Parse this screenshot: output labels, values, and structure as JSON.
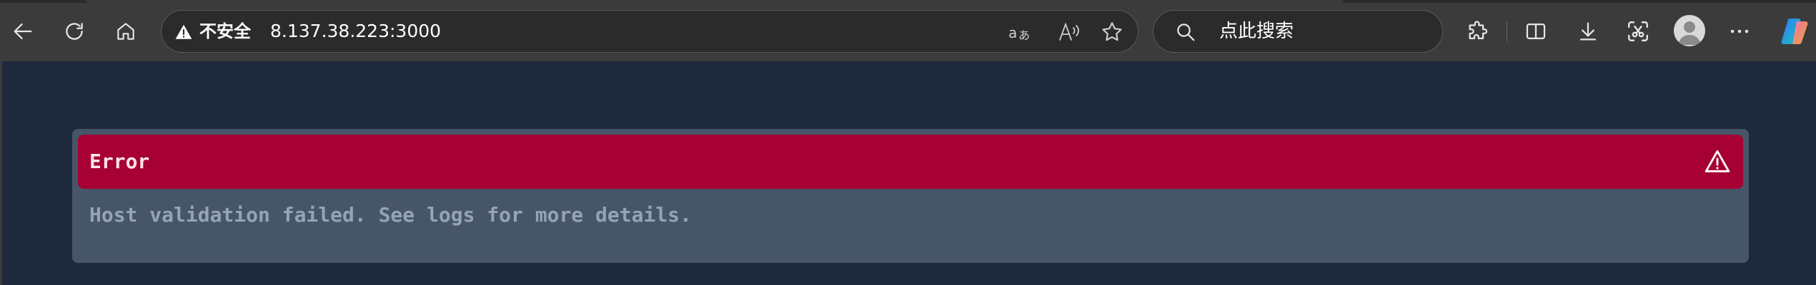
{
  "browser": {
    "security_label": "不安全",
    "url": "8.137.38.223:3000",
    "search_placeholder": "点此搜索",
    "icons": {
      "back": "back-arrow-icon",
      "refresh": "refresh-icon",
      "home": "home-icon",
      "security": "warning-triangle-icon",
      "translate": "translate-icon",
      "read_aloud": "read-aloud-icon",
      "favorite": "star-icon",
      "search": "search-icon",
      "extensions": "puzzle-icon",
      "split_screen": "split-screen-icon",
      "downloads": "download-icon",
      "screenshot": "screenshot-icon",
      "profile": "avatar",
      "more": "ellipsis-icon",
      "copilot": "copilot-icon"
    },
    "colors": {
      "toolbar_bg": "#3b3b3b",
      "field_bg": "#2b2b2b"
    }
  },
  "page": {
    "error": {
      "title": "Error",
      "message": "Host validation failed. See logs for more details.",
      "icon": "warning-triangle-icon"
    },
    "colors": {
      "page_bg": "#1e293b",
      "card_bg": "#475569",
      "header_bg": "#a60034",
      "title_text": "#ffe4e6",
      "message_text": "#94a3b8"
    }
  }
}
